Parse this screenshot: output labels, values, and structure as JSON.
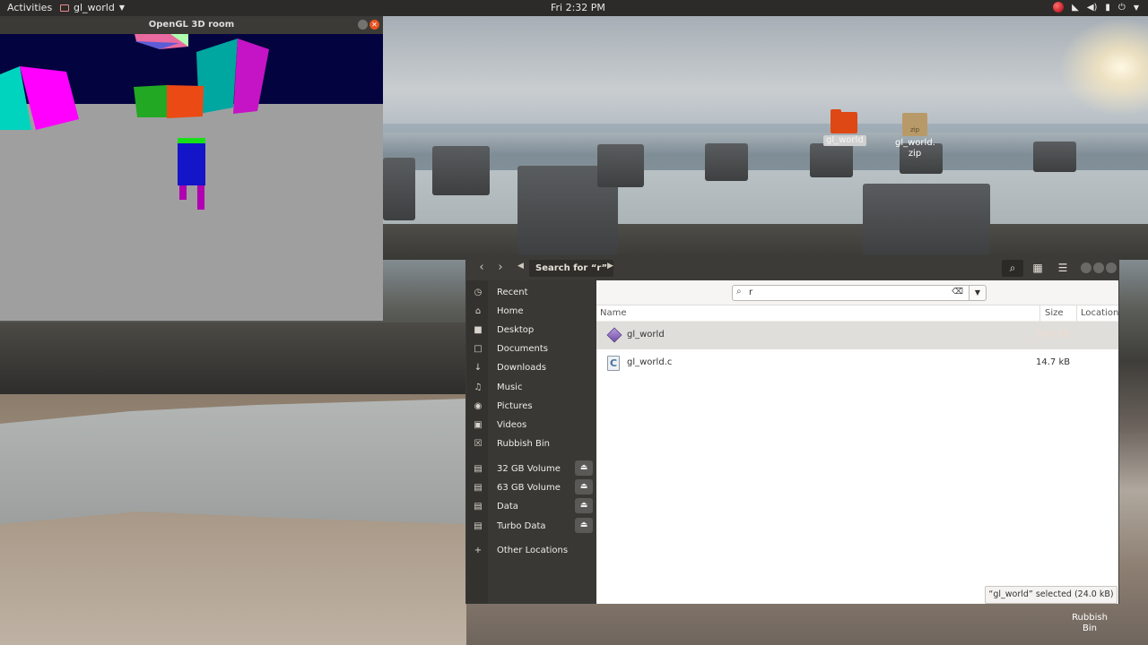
{
  "topbar": {
    "activities": "Activities",
    "app_name": "gl_world",
    "clock": "Fri  2:32 PM"
  },
  "gl_window": {
    "title": "OpenGL 3D room"
  },
  "desktop": {
    "folder_label": "gl_world",
    "zip_label_line1": "gl_world.",
    "zip_label_line2": "zip",
    "zip_badge": "zip",
    "bin_label": "Rubbish Bin"
  },
  "files": {
    "breadcrumb": "Search for “r”",
    "sidebar": [
      {
        "label": "Recent",
        "icon": "clock-icon",
        "glyph": "◷"
      },
      {
        "label": "Home",
        "icon": "home-icon",
        "glyph": "⌂"
      },
      {
        "label": "Desktop",
        "icon": "folder-icon",
        "glyph": "■"
      },
      {
        "label": "Documents",
        "icon": "document-icon",
        "glyph": "□"
      },
      {
        "label": "Downloads",
        "icon": "download-icon",
        "glyph": "↓"
      },
      {
        "label": "Music",
        "icon": "music-icon",
        "glyph": "♫"
      },
      {
        "label": "Pictures",
        "icon": "camera-icon",
        "glyph": "◉"
      },
      {
        "label": "Videos",
        "icon": "video-icon",
        "glyph": "▣"
      },
      {
        "label": "Rubbish Bin",
        "icon": "trash-icon",
        "glyph": "☒"
      },
      {
        "label": "32 GB Volume",
        "icon": "drive-icon",
        "glyph": "▤",
        "eject": true
      },
      {
        "label": "63 GB Volume",
        "icon": "drive-icon",
        "glyph": "▤",
        "eject": true
      },
      {
        "label": "Data",
        "icon": "drive-icon",
        "glyph": "▤",
        "eject": true
      },
      {
        "label": "Turbo Data",
        "icon": "drive-icon",
        "glyph": "▤",
        "eject": true
      },
      {
        "label": "Other Locations",
        "icon": "plus-icon",
        "glyph": "+"
      }
    ],
    "search_value": "r",
    "columns": {
      "name": "Name",
      "size": "Size",
      "location": "Location"
    },
    "rows": [
      {
        "name": "gl_world",
        "size": "24.0 kB",
        "type": "executable",
        "selected": true
      },
      {
        "name": "gl_world.c",
        "size": "14.7 kB",
        "type": "c-source",
        "selected": false
      }
    ],
    "status": "“gl_world” selected  (24.0 kB)"
  }
}
